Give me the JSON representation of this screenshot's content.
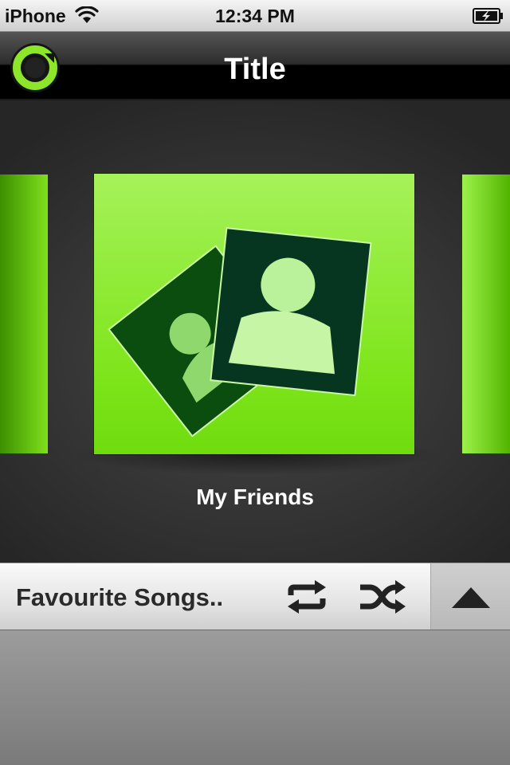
{
  "status_bar": {
    "carrier": "iPhone",
    "time": "12:34 PM",
    "wifi_icon": "wifi-icon",
    "battery_icon": "battery-charging-icon"
  },
  "nav": {
    "title": "Title",
    "logo_icon": "app-logo-ring"
  },
  "carousel": {
    "selected_label": "My Friends",
    "selected_icon": "friends-photos-icon",
    "accent_color": "#7fe51c"
  },
  "player": {
    "now_playing": "Favourite Songs..",
    "repeat_icon": "repeat-icon",
    "shuffle_icon": "shuffle-icon",
    "expand_icon": "triangle-up-icon"
  }
}
